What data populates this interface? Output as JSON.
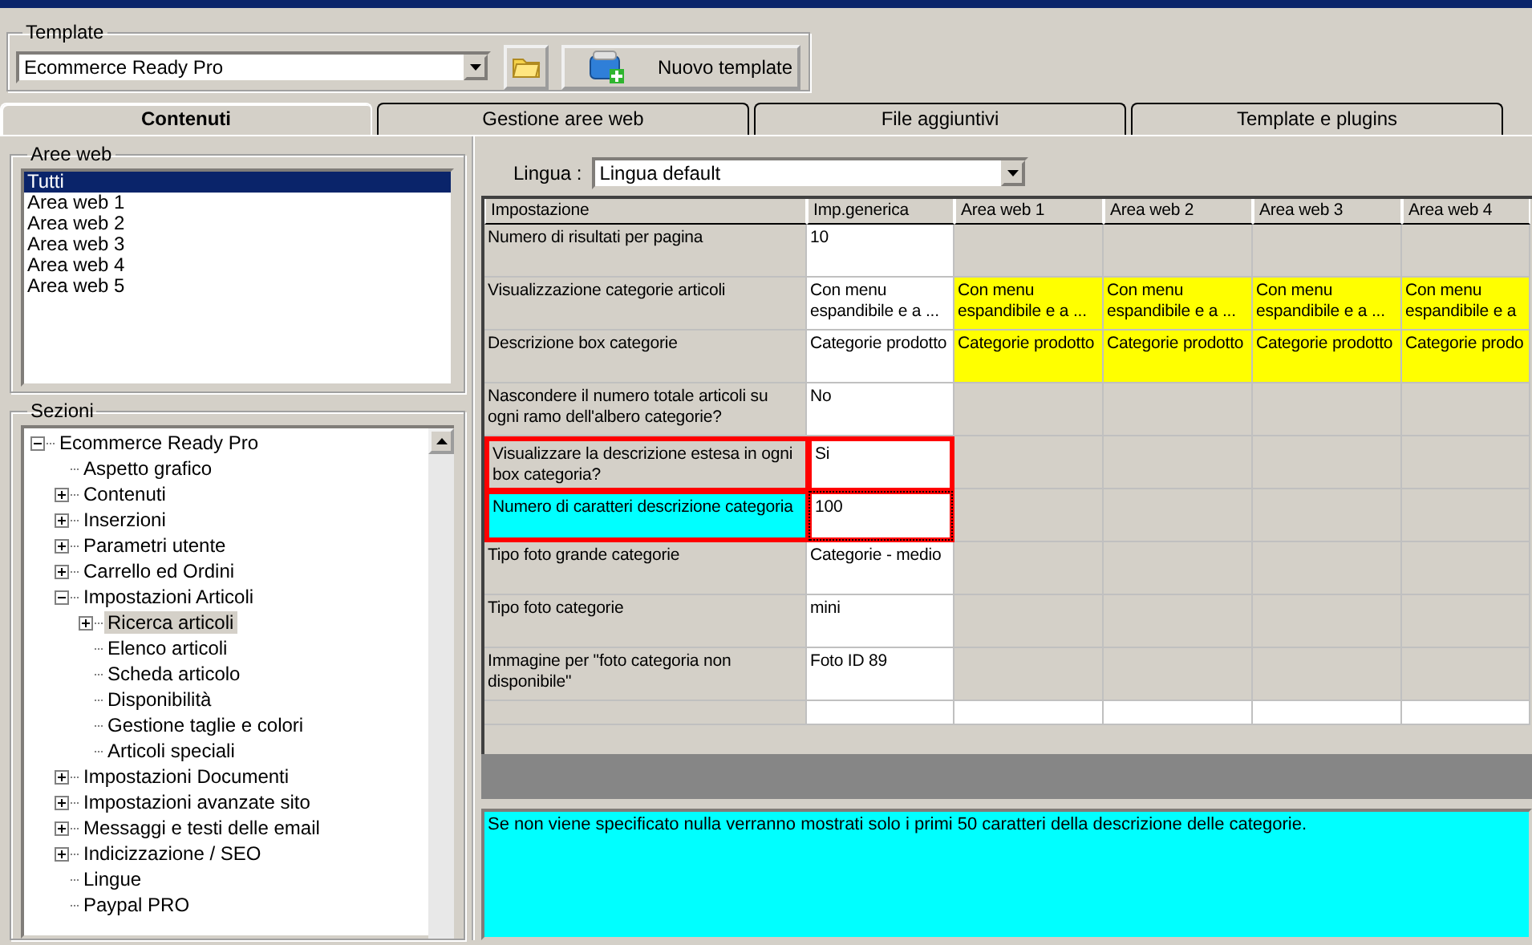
{
  "template": {
    "label": "Template",
    "value": "Ecommerce Ready Pro",
    "new_button": "Nuovo template"
  },
  "tabs": [
    {
      "label": "Contenuti",
      "selected": true
    },
    {
      "label": "Gestione aree web",
      "selected": false
    },
    {
      "label": "File aggiuntivi",
      "selected": false
    },
    {
      "label": "Template e plugins",
      "selected": false
    }
  ],
  "aree_web": {
    "label": "Aree web",
    "items": [
      {
        "label": "Tutti",
        "selected": true
      },
      {
        "label": "Area web 1",
        "selected": false
      },
      {
        "label": "Area web 2",
        "selected": false
      },
      {
        "label": "Area web 3",
        "selected": false
      },
      {
        "label": "Area web 4",
        "selected": false
      },
      {
        "label": "Area web 5",
        "selected": false
      }
    ]
  },
  "sezioni": {
    "label": "Sezioni",
    "tree": [
      {
        "label": "Ecommerce Ready Pro",
        "expanded": true,
        "selected": false,
        "children": [
          {
            "label": "Aspetto grafico",
            "selected": false
          },
          {
            "label": "Contenuti",
            "expanded": false,
            "selected": false
          },
          {
            "label": "Inserzioni",
            "expanded": false,
            "selected": false
          },
          {
            "label": "Parametri utente",
            "expanded": false,
            "selected": false
          },
          {
            "label": "Carrello ed Ordini",
            "expanded": false,
            "selected": false
          },
          {
            "label": "Impostazioni Articoli",
            "expanded": true,
            "selected": false,
            "children": [
              {
                "label": "Ricerca articoli",
                "expanded": false,
                "selected": true
              },
              {
                "label": "Elenco articoli",
                "selected": false
              },
              {
                "label": "Scheda articolo",
                "selected": false
              },
              {
                "label": "Disponibilità",
                "selected": false
              },
              {
                "label": "Gestione taglie e colori",
                "selected": false
              },
              {
                "label": "Articoli speciali",
                "selected": false
              }
            ]
          },
          {
            "label": "Impostazioni Documenti",
            "expanded": false,
            "selected": false
          },
          {
            "label": "Impostazioni avanzate sito",
            "expanded": false,
            "selected": false
          },
          {
            "label": "Messaggi e testi delle email",
            "expanded": false,
            "selected": false
          },
          {
            "label": "Indicizzazione / SEO",
            "expanded": false,
            "selected": false
          },
          {
            "label": "Lingue",
            "selected": false
          },
          {
            "label": "Paypal PRO",
            "selected": false
          }
        ]
      }
    ]
  },
  "lingua": {
    "label": "Lingua :",
    "value": "Lingua default"
  },
  "grid": {
    "columns": [
      "Impostazione",
      "Imp.generica",
      "Area web 1",
      "Area web 2",
      "Area web 3",
      "Area web 4"
    ],
    "rows": [
      {
        "setting": "Numero di risultati per pagina",
        "generic": "10",
        "selected": false,
        "highlighted": false
      },
      {
        "setting": "Visualizzazione categorie articoli",
        "generic": "Con menu espandibile e a ...",
        "selected": false,
        "highlighted": false,
        "area_values": [
          "Con menu espandibile e a ...",
          "Con menu espandibile e a ...",
          "Con menu espandibile e a ...",
          "Con menu espandibile e a"
        ]
      },
      {
        "setting": "Descrizione box categorie",
        "generic": "Categorie prodotto",
        "selected": false,
        "highlighted": false,
        "area_values": [
          "Categorie prodotto",
          "Categorie prodotto",
          "Categorie prodotto",
          "Categorie prodo"
        ]
      },
      {
        "setting": "Nascondere il numero totale articoli su ogni ramo dell'albero categorie?",
        "generic": "No",
        "selected": false,
        "highlighted": false
      },
      {
        "setting": "Visualizzare la descrizione estesa in ogni box categoria?",
        "generic": "Si",
        "selected": false,
        "highlighted": true
      },
      {
        "setting": "Numero di caratteri descrizione categoria",
        "generic": "100",
        "selected": true,
        "highlighted": true
      },
      {
        "setting": "Tipo foto grande categorie",
        "generic": "Categorie - medio",
        "selected": false,
        "highlighted": false
      },
      {
        "setting": "Tipo foto categorie",
        "generic": "mini",
        "selected": false,
        "highlighted": false
      },
      {
        "setting": "Immagine per \"foto categoria non disponibile\"",
        "generic": "Foto ID 89",
        "selected": false,
        "highlighted": false
      }
    ]
  },
  "description": "Se non viene specificato nulla verranno mostrati solo i primi 50 caratteri della descrizione delle categorie."
}
